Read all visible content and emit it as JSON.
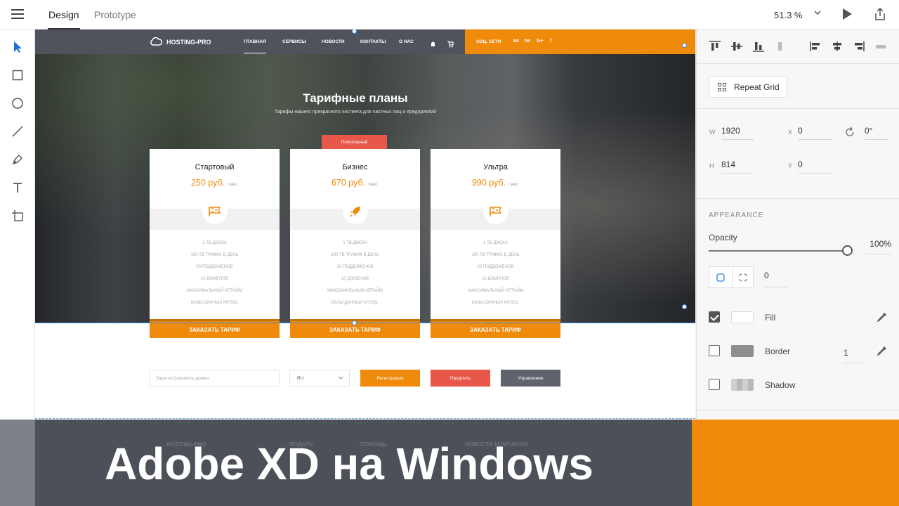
{
  "topbar": {
    "tabs": [
      {
        "label": "Design",
        "active": true
      },
      {
        "label": "Prototype",
        "active": false
      }
    ],
    "zoom": "51.3 %"
  },
  "toolbar": {
    "tools": [
      "select-tool",
      "rectangle-tool",
      "ellipse-tool",
      "line-tool",
      "pen-tool",
      "text-tool",
      "artboard-tool"
    ]
  },
  "site": {
    "logo": "HOSTING-PRO",
    "nav": [
      "ГЛАВНАЯ",
      "СЕРВИСЫ",
      "НОВОСТИ",
      "КОНТАКТЫ",
      "О НАС"
    ],
    "social_label": "СОЦ. СЕТИ",
    "social_icons": [
      "вк",
      "tw",
      "G+",
      "f"
    ],
    "hero_title": "Тарифные планы",
    "hero_subtitle": "Тарифы нашего прекрасного хостинга для частных лиц и предприятий",
    "popular_label": "Популярный",
    "plans": [
      {
        "name": "Стартовый",
        "price": "250 руб.",
        "per": "/ мес.",
        "icon": "flag-icon"
      },
      {
        "name": "Бизнес",
        "price": "670 руб.",
        "per": "/ мес.",
        "icon": "rocket-icon"
      },
      {
        "name": "Ультра",
        "price": "990 руб.",
        "per": "/ мес.",
        "icon": "flag-icon"
      }
    ],
    "features": [
      "1 ТВ ДИСКА",
      "100 ТВ ТРАФИК В ДЕНЬ",
      "20 ПОДДОМЕНОВ",
      "10 ДОМЕНОВ",
      "МАКСИМАЛЬНЫЙ АПТАЙМ",
      "БАЗЫ ДАННЫХ MYSQL"
    ],
    "order_label": "ЗАКАЗАТЬ ТАРИФ",
    "domain_placeholder": "Зарегистрировать домен",
    "lang": "RU",
    "buttons": [
      {
        "label": "Регистрация",
        "color": "#ef8a0b"
      },
      {
        "label": "Продлить",
        "color": "#e8584a"
      },
      {
        "label": "Управление",
        "color": "#5f636b"
      }
    ],
    "footer_ghost": [
      "HOSTING-PRO",
      "ПОДАТЬ",
      "ПОМОЩЬ",
      "НОВОСТИ КОМПАНИИ"
    ],
    "colors": {
      "accent": "#ef8a0b",
      "popular": "#e8584a",
      "nav": "#4f545c"
    }
  },
  "panel": {
    "repeat_grid": "Repeat Grid",
    "w_label": "W",
    "w": "1920",
    "h_label": "H",
    "h": "814",
    "x_label": "X",
    "x": "0",
    "y_label": "Y",
    "y": "0",
    "rotation": "0°",
    "appearance": "APPEARANCE",
    "opacity_label": "Opacity",
    "opacity": "100%",
    "opacity_level": 1.0,
    "corner_radius": "0",
    "fill_label": "Fill",
    "fill_checked": true,
    "border_label": "Border",
    "border_width": "1",
    "shadow_label": "Shadow"
  },
  "banner": {
    "title": "Adobe XD на Windows"
  }
}
